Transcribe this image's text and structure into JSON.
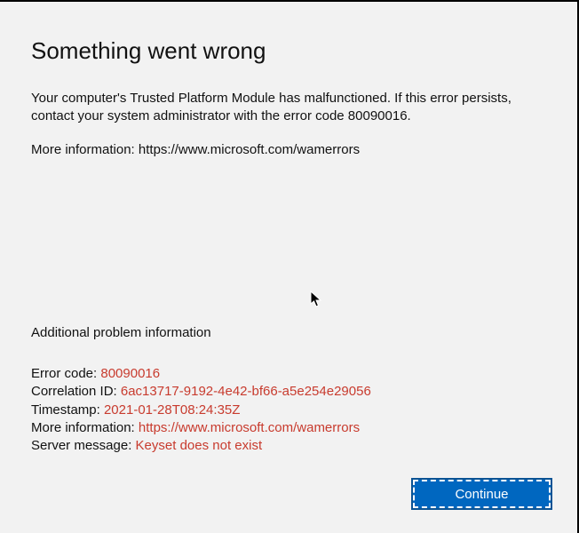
{
  "title": "Something went wrong",
  "body": "Your computer's Trusted Platform Module has malfunctioned. If this error persists, contact your system administrator with the error code 80090016.",
  "more_info_prefix": "More information: ",
  "more_info_url_text": "https://www.microsoft.com/wamerrors",
  "additional_header": "Additional problem information",
  "fields": {
    "error_code": {
      "label": "Error code: ",
      "value": "80090016"
    },
    "correlation_id": {
      "label": "Correlation ID: ",
      "value": "6ac13717-9192-4e42-bf66-a5e254e29056"
    },
    "timestamp": {
      "label": "Timestamp: ",
      "value": "2021-01-28T08:24:35Z"
    },
    "more_info": {
      "label": "More information: ",
      "value": "https://www.microsoft.com/wamerrors"
    },
    "server_message": {
      "label": "Server message: ",
      "value": "Keyset does not exist"
    }
  },
  "buttons": {
    "continue": "Continue"
  },
  "colors": {
    "error_value": "#c83b2e",
    "button_bg": "#0067c0"
  }
}
